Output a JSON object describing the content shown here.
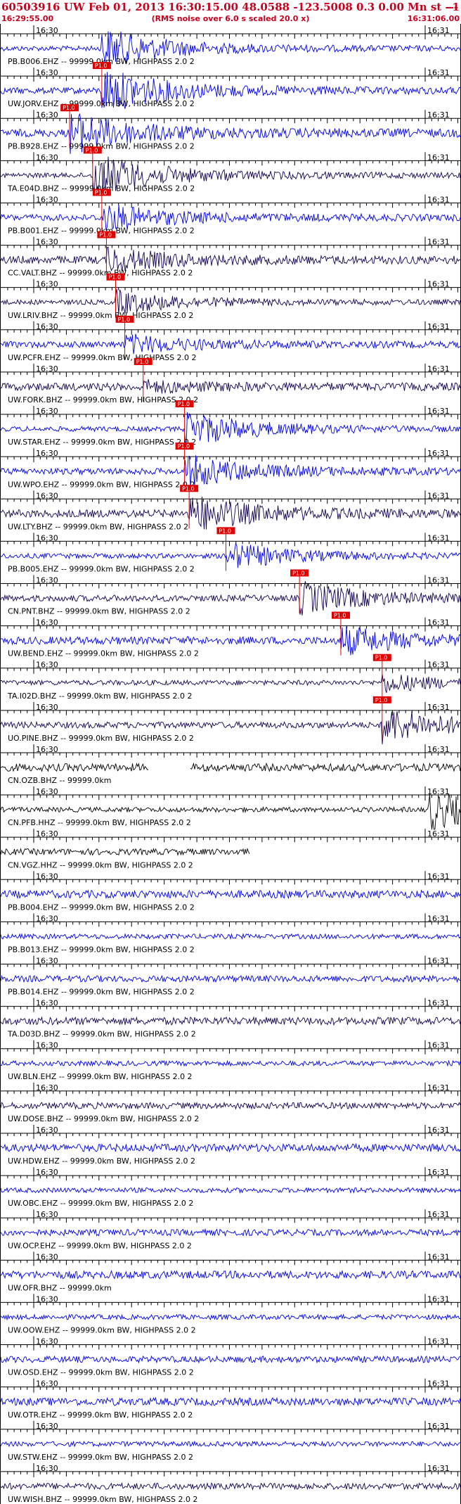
{
  "header": {
    "title": "60503916 UW Feb 01, 2013 16:30:15.00   48.0588 -123.5008  0.3 0.00 Mn st --- -- --",
    "title_right": "-1",
    "start_time": "16:29:55.00",
    "subtitle": "(RMS noise over 6.0 s scaled 20.0 x)",
    "end_time": "16:31:06.00"
  },
  "colors": {
    "header_red": "#c8001e",
    "trace_blue": "#0000e6",
    "trace_navy": "#14004e",
    "trace_black": "#000000",
    "pick_red": "#e00000",
    "pick_line": "#e00000"
  },
  "chart_data": {
    "type": "seismogram",
    "time_range": [
      "16:29:55.00",
      "16:31:06.00"
    ],
    "tick_labels": [
      "16:30",
      "16:31"
    ],
    "traces": [
      {
        "label": "PB.B006.EHZ -- 99999.0km BW, HIGHPASS  2.0  2",
        "color": "#0000e6",
        "pick": null,
        "onset": 0.22,
        "event_amp": 0.9
      },
      {
        "label": "UW.JORV.EHZ -- 99999.0km BW, HIGHPASS  2.0  2",
        "color": "#0000e6",
        "pick": "P1.0",
        "onset": 0.22,
        "event_amp": 1.0
      },
      {
        "label": "PB.B928.EHZ -- 99999.0km BW, HIGHPASS  2.0  2",
        "color": "#0000e6",
        "pick": "P1.0",
        "onset": 0.15,
        "event_amp": 0.9
      },
      {
        "label": "TA.E04D.BHZ -- 99999.0km BW, HIGHPASS  2.0  2",
        "color": "#14004e",
        "pick": "P1.0",
        "onset": 0.2,
        "event_amp": 1.0
      },
      {
        "label": "PB.B001.EHZ -- 99999.0km BW, HIGHPASS  2.0  2",
        "color": "#0000e6",
        "pick": "P1.0",
        "onset": 0.22,
        "event_amp": 0.6
      },
      {
        "label": "CC.VALT.BHZ -- 99999.0km BW, HIGHPASS  2.0  2",
        "color": "#14004e",
        "pick": "P1.0",
        "onset": 0.23,
        "event_amp": 0.5
      },
      {
        "label": "UW.LRIV.BHZ -- 99999.0km BW, HIGHPASS  2.0  2",
        "color": "#14004e",
        "pick": "P1.0",
        "onset": 0.25,
        "event_amp": 0.5
      },
      {
        "label": "UW.PCFR.EHZ -- 99999.0km BW, HIGHPASS  2.0  2",
        "color": "#0000e6",
        "pick": "P1.0",
        "onset": 0.27,
        "event_amp": 0.4
      },
      {
        "label": "UW.FORK.BHZ -- 99999.0km BW, HIGHPASS  2.0  2",
        "color": "#14004e",
        "pick": "P1.0",
        "onset": 0.31,
        "event_amp": 0.2
      },
      {
        "label": "UW.STAR.EHZ -- 99999.0km BW, HIGHPASS  2.0  2",
        "color": "#0000e6",
        "pick": "P1.0",
        "onset": 0.4,
        "event_amp": 0.8
      },
      {
        "label": "UW.WPO.EHZ -- 99999.0km BW, HIGHPASS  2.0  2",
        "color": "#0000e6",
        "pick": "P1.0",
        "onset": 0.4,
        "event_amp": 0.7
      },
      {
        "label": "UW.LTY.BHZ -- 99999.0km BW, HIGHPASS  2.0  2",
        "color": "#14004e",
        "pick": "P1.0",
        "onset": 0.41,
        "event_amp": 0.8
      },
      {
        "label": "PB.B005.EHZ -- 99999.0km BW, HIGHPASS  2.0  2",
        "color": "#0000e6",
        "pick": "P1.0",
        "onset": 0.49,
        "event_amp": 0.6
      },
      {
        "label": "CN.PNT.BHZ -- 99999.0km BW, HIGHPASS  2.0  2",
        "color": "#14004e",
        "pick": "P1.0",
        "onset": 0.65,
        "event_amp": 0.7
      },
      {
        "label": "UW.BEND.EHZ -- 99999.0km BW, HIGHPASS  2.0  2",
        "color": "#0000e6",
        "pick": "P1.0",
        "onset": 0.74,
        "event_amp": 0.6
      },
      {
        "label": "TA.I02D.BHZ -- 99999.0km BW, HIGHPASS  2.0  2",
        "color": "#14004e",
        "pick": "P1.0",
        "onset": 0.83,
        "event_amp": 0.4
      },
      {
        "label": "UO.PINE.BHZ -- 99999.0km BW, HIGHPASS  2.0  2",
        "color": "#14004e",
        "pick": "P1.0",
        "onset": 0.83,
        "event_amp": 0.8
      },
      {
        "label": "CN.OZB.BHZ -- 99999.0km",
        "color": "#000000",
        "pick": null,
        "onset": null,
        "event_amp": 0
      },
      {
        "label": "CN.PFB.HHZ -- 99999.0km BW, HIGHPASS  2.0  2",
        "color": "#000000",
        "pick": null,
        "onset": 0.93,
        "event_amp": 0.9
      },
      {
        "label": "CN.VGZ.HHZ -- 99999.0km BW, HIGHPASS  2.0  2",
        "color": "#000000",
        "pick": null,
        "onset": null,
        "event_amp": 0
      },
      {
        "label": "PB.B004.EHZ -- 99999.0km BW, HIGHPASS  2.0  2",
        "color": "#0000e6",
        "pick": null,
        "onset": null,
        "event_amp": 0
      },
      {
        "label": "PB.B013.EHZ -- 99999.0km BW, HIGHPASS  2.0  2",
        "color": "#0000e6",
        "pick": null,
        "onset": null,
        "event_amp": 0
      },
      {
        "label": "PB.B014.EHZ -- 99999.0km BW, HIGHPASS  2.0  2",
        "color": "#0000e6",
        "pick": null,
        "onset": null,
        "event_amp": 0
      },
      {
        "label": "TA.D03D.BHZ -- 99999.0km BW, HIGHPASS  2.0  2",
        "color": "#14004e",
        "pick": null,
        "onset": null,
        "event_amp": 0
      },
      {
        "label": "UW.BLN.EHZ -- 99999.0km BW, HIGHPASS  2.0  2",
        "color": "#0000e6",
        "pick": null,
        "onset": null,
        "event_amp": 0
      },
      {
        "label": "UW.DOSE.BHZ -- 99999.0km BW, HIGHPASS  2.0  2",
        "color": "#14004e",
        "pick": null,
        "onset": null,
        "event_amp": 0
      },
      {
        "label": "UW.HDW.EHZ -- 99999.0km BW, HIGHPASS  2.0  2",
        "color": "#0000e6",
        "pick": null,
        "onset": null,
        "event_amp": 0
      },
      {
        "label": "UW.OBC.EHZ -- 99999.0km BW, HIGHPASS  2.0  2",
        "color": "#0000e6",
        "pick": null,
        "onset": null,
        "event_amp": 0
      },
      {
        "label": "UW.OCP.EHZ -- 99999.0km BW, HIGHPASS  2.0  2",
        "color": "#0000e6",
        "pick": null,
        "onset": null,
        "event_amp": 0
      },
      {
        "label": "UW.OFR.BHZ -- 99999.0km",
        "color": "#0000e6",
        "pick": null,
        "onset": null,
        "event_amp": 0
      },
      {
        "label": "UW.OOW.EHZ -- 99999.0km BW, HIGHPASS  2.0  2",
        "color": "#0000e6",
        "pick": null,
        "onset": null,
        "event_amp": 0
      },
      {
        "label": "UW.OSD.EHZ -- 99999.0km BW, HIGHPASS  2.0  2",
        "color": "#0000e6",
        "pick": null,
        "onset": null,
        "event_amp": 0
      },
      {
        "label": "UW.OTR.EHZ -- 99999.0km BW, HIGHPASS  2.0  2",
        "color": "#0000e6",
        "pick": null,
        "onset": null,
        "event_amp": 0
      },
      {
        "label": "UW.STW.EHZ -- 99999.0km BW, HIGHPASS  2.0  2",
        "color": "#0000e6",
        "pick": null,
        "onset": null,
        "event_amp": 0
      },
      {
        "label": "UW.WISH.BHZ -- 99999.0km BW, HIGHPASS  2.0  2",
        "color": "#14004e",
        "pick": null,
        "onset": null,
        "event_amp": 0
      }
    ]
  }
}
